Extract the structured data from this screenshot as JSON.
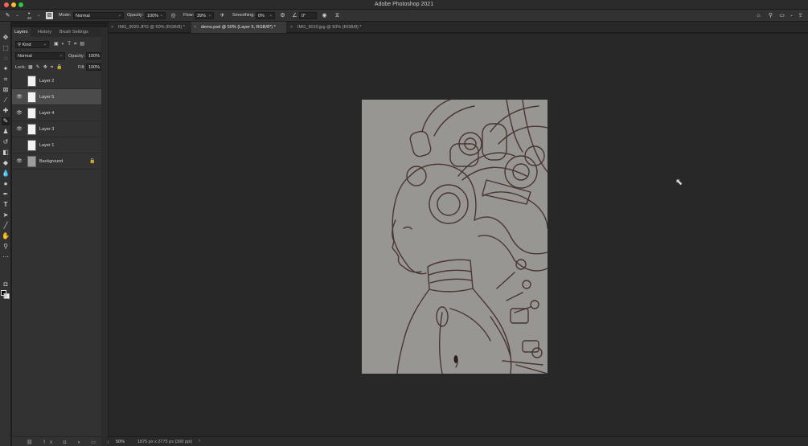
{
  "app": {
    "title": "Adobe Photoshop 2021"
  },
  "options_bar": {
    "brush_size": "20",
    "mode_label": "Mode:",
    "mode_value": "Normal",
    "opacity_label": "Opacity:",
    "opacity_value": "100%",
    "flow_label": "Flow:",
    "flow_value": "39%",
    "smoothing_label": "Smoothing:",
    "smoothing_value": "0%",
    "angle_value": "0°"
  },
  "doc_tabs": [
    {
      "label": "IMG_9020.JPG @ 50% (RGB/8) *",
      "active": false
    },
    {
      "label": "demo.psd @ 50% (Layer 5, RGB/8*) *",
      "active": true
    },
    {
      "label": "IMG_9010.jpg @ 50% (RGB/8) *",
      "active": false
    }
  ],
  "panel": {
    "tabs": [
      "Layers",
      "History",
      "Brush Settings"
    ],
    "kind_label": "Kind",
    "blend_mode": "Normal",
    "opacity_label": "Opacity:",
    "opacity_value": "100%",
    "lock_label": "Lock:",
    "fill_label": "Fill:",
    "fill_value": "100%",
    "layers": [
      {
        "name": "Layer 2",
        "visible": false,
        "selected": false
      },
      {
        "name": "Layer 5",
        "visible": true,
        "selected": true
      },
      {
        "name": "Layer 4",
        "visible": true,
        "selected": false
      },
      {
        "name": "Layer 3",
        "visible": true,
        "selected": false
      },
      {
        "name": "Layer 1",
        "visible": false,
        "selected": false
      },
      {
        "name": "Background",
        "visible": true,
        "selected": false,
        "locked": true
      }
    ],
    "footer_icons": [
      "link-icon",
      "fx-icon",
      "mask-icon",
      "adjustment-icon",
      "group-icon",
      "new-layer-icon",
      "trash-icon"
    ]
  },
  "status": {
    "zoom": "50%",
    "doc_size": "1875 px x 2775 px (300 ppi)"
  },
  "colors": {
    "foreground": "#000000",
    "background": "#ffffff",
    "canvas": "#979692",
    "sketch_line": "#4a3530"
  }
}
